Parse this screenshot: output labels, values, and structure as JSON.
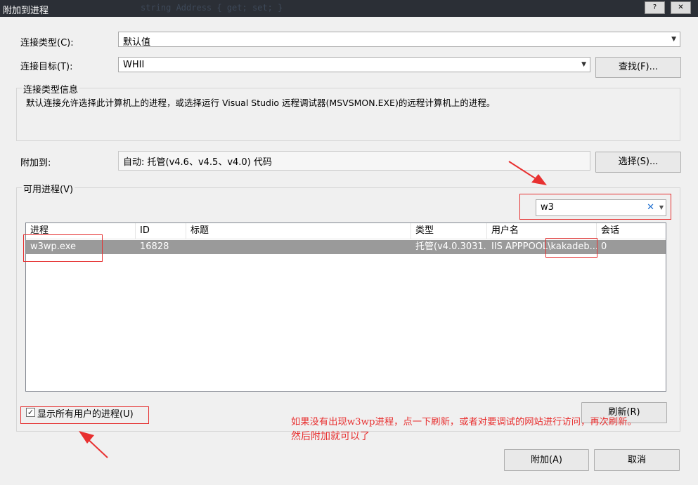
{
  "window": {
    "title": "附加到进程",
    "background_code": "string Address { get; set; }",
    "help_label": "?",
    "close_label": "✕"
  },
  "form": {
    "connection_type_label": "连接类型(C):",
    "connection_type_value": "默认值",
    "connection_target_label": "连接目标(T):",
    "connection_target_value": "WHII",
    "find_button": "查找(F)...",
    "info_group_title": "连接类型信息",
    "info_text": "默认连接允许选择此计算机上的进程，或选择运行 Visual Studio 远程调试器(MSVSMON.EXE)的远程计算机上的进程。",
    "attach_to_label": "附加到:",
    "attach_to_value": "自动: 托管(v4.6、v4.5、v4.0) 代码",
    "select_button": "选择(S)..."
  },
  "processes": {
    "group_title": "可用进程(V)",
    "filter_value": "w3",
    "columns": [
      "进程",
      "ID",
      "标题",
      "类型",
      "用户名",
      "会话"
    ],
    "rows": [
      {
        "process": "w3wp.exe",
        "id": "16828",
        "title": "",
        "type": "托管(v4.0.3031...",
        "user": "IIS APPPOOL\\kakadeb...",
        "session": "0"
      }
    ],
    "show_all_users_label": "显示所有用户的进程(U)",
    "show_all_users_checked": true,
    "refresh_button": "刷新(R)"
  },
  "footer": {
    "attach_button": "附加(A)",
    "cancel_button": "取消"
  },
  "annotation": {
    "line1": "如果没有出现w3wp进程，点一下刷新，或者对要调试的网站进行访问，再次刷新。",
    "line2": "然后附加就可以了",
    "color": "#e83030"
  }
}
